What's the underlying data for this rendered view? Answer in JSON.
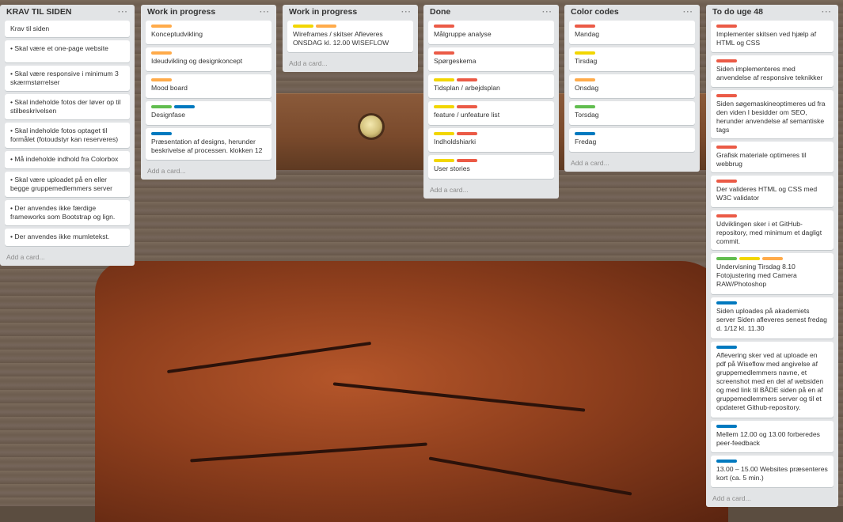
{
  "colors": {
    "red": "#eb5a46",
    "orange": "#ffab4a",
    "yellow": "#f2d600",
    "green": "#61bd4f",
    "blue": "#0079bf"
  },
  "icons": {
    "list_menu": "ellipsis-icon"
  },
  "lists": [
    {
      "title": "KRAV TIL SIDEN",
      "menu": "···",
      "add_card": "Add a card...",
      "cards": [
        {
          "labels": [],
          "text": "Krav til siden"
        },
        {
          "labels": [],
          "text": "• Skal være et one-page website"
        },
        {
          "labels": [],
          "text": "• Skal være responsive i minimum 3 skærmstørrelser"
        },
        {
          "labels": [],
          "text": "• Skal indeholde fotos der løver op til stilbeskrivelsen"
        },
        {
          "labels": [],
          "text": "• Skal indeholde fotos optaget til formålet (fotoudstyr kan reserveres)"
        },
        {
          "labels": [],
          "text": "• Må indeholde indhold fra Colorbox"
        },
        {
          "labels": [],
          "text": "• Skal være uploadet på en eller begge gruppemedlemmers server"
        },
        {
          "labels": [],
          "text": "• Der anvendes ikke færdige frameworks som Bootstrap og lign."
        },
        {
          "labels": [],
          "text": "• Der anvendes ikke mumletekst."
        }
      ]
    },
    {
      "title": "Work in progress",
      "menu": "···",
      "add_card": "Add a card...",
      "cards": [
        {
          "labels": [
            "orange"
          ],
          "text": "Konceptudvikling"
        },
        {
          "labels": [
            "orange"
          ],
          "text": "Ideudvikling og designkoncept"
        },
        {
          "labels": [
            "orange"
          ],
          "text": "Mood board"
        },
        {
          "labels": [
            "green",
            "blue"
          ],
          "text": "Designfase"
        },
        {
          "labels": [
            "blue"
          ],
          "text": "Præsentation af designs, herunder beskrivelse af processen. klokken 12"
        }
      ]
    },
    {
      "title": "Work in progress",
      "menu": "···",
      "add_card": "Add a card...",
      "cards": [
        {
          "labels": [
            "yellow",
            "orange"
          ],
          "text": "Wireframes / skitser Afleveres ONSDAG kl. 12.00 WISEFLOW"
        }
      ]
    },
    {
      "title": "Done",
      "menu": "···",
      "add_card": "Add a card...",
      "cards": [
        {
          "labels": [
            "red"
          ],
          "text": "Målgruppe analyse"
        },
        {
          "labels": [
            "red"
          ],
          "text": "Spørgeskema"
        },
        {
          "labels": [
            "yellow",
            "red"
          ],
          "text": "Tidsplan / arbejdsplan"
        },
        {
          "labels": [
            "yellow",
            "red"
          ],
          "text": "feature / unfeature list"
        },
        {
          "labels": [
            "yellow",
            "red"
          ],
          "text": "Indholdshiarki"
        },
        {
          "labels": [
            "yellow",
            "red"
          ],
          "text": "User stories"
        }
      ]
    },
    {
      "title": "Color codes",
      "menu": "···",
      "add_card": "Add a card...",
      "cards": [
        {
          "labels": [
            "red"
          ],
          "text": "Mandag"
        },
        {
          "labels": [
            "yellow"
          ],
          "text": "Tirsdag"
        },
        {
          "labels": [
            "orange"
          ],
          "text": "Onsdag"
        },
        {
          "labels": [
            "green"
          ],
          "text": "Torsdag"
        },
        {
          "labels": [
            "blue"
          ],
          "text": "Fredag"
        }
      ]
    },
    {
      "title": "To do uge 48",
      "menu": "···",
      "add_card": "Add a card...",
      "cards": [
        {
          "labels": [
            "red"
          ],
          "text": "Implementer skitsen ved hjælp af HTML og CSS"
        },
        {
          "labels": [
            "red"
          ],
          "text": "Siden implementeres med anvendelse af responsive teknikker"
        },
        {
          "labels": [
            "red"
          ],
          "text": "Siden søgemaskineoptimeres ud fra den viden I besidder om SEO, herunder anvendelse af semantiske tags"
        },
        {
          "labels": [
            "red"
          ],
          "text": "Grafisk materiale optimeres til webbrug"
        },
        {
          "labels": [
            "red"
          ],
          "text": "Der valideres HTML og CSS med W3C validator"
        },
        {
          "labels": [
            "red"
          ],
          "text": "Udviklingen sker i et GitHub-repository, med minimum et dagligt commit."
        },
        {
          "labels": [
            "green",
            "yellow",
            "orange"
          ],
          "text": "Undervisning Tirsdag 8.10 Fotojustering med Camera RAW/Photoshop"
        },
        {
          "labels": [
            "blue"
          ],
          "text": "Siden uploades på akademiets server Siden afleveres senest fredag d. 1/12 kl. 11.30"
        },
        {
          "labels": [
            "blue"
          ],
          "text": "Aflevering sker ved at uploade en pdf på Wiseflow med angivelse af gruppemedlemmers navne, et screenshot med en del af websiden og med link til BÅDE siden på en af gruppemedlemmers server og til et opdateret Github-repository."
        },
        {
          "labels": [
            "blue"
          ],
          "text": "Mellem 12.00 og 13.00 forberedes peer-feedback"
        },
        {
          "labels": [
            "blue"
          ],
          "text": "13.00 – 15.00 Websites præsenteres kort (ca. 5 min.)"
        }
      ]
    }
  ]
}
